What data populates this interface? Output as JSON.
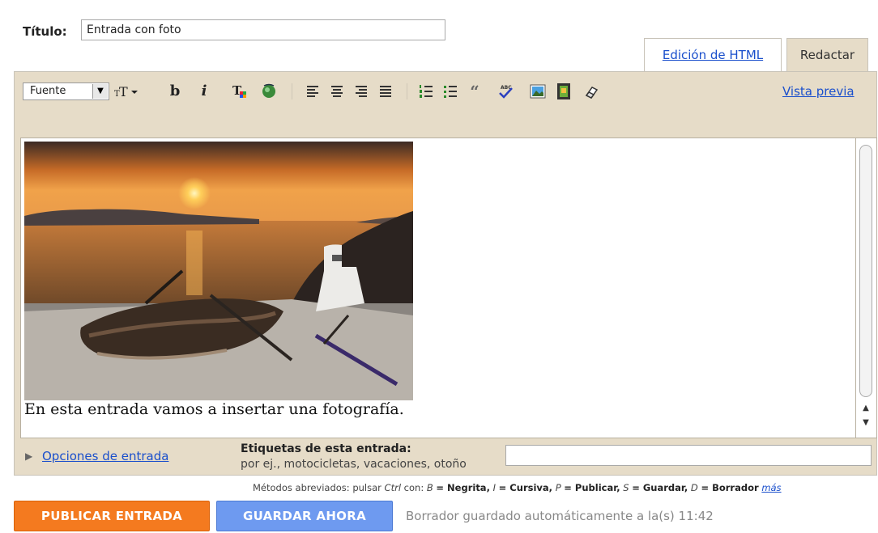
{
  "post": {
    "title_label": "Título:",
    "title_value": "Entrada con foto"
  },
  "tabs": {
    "html_label": "Edición de HTML",
    "compose_label": "Redactar"
  },
  "toolbar": {
    "font_label": "Fuente",
    "font_size_label": "TT",
    "bold_label": "b",
    "italic_label": "i",
    "preview_label": "Vista previa",
    "icons": [
      "font-size-icon",
      "bold-icon",
      "italic-icon",
      "text-color-icon",
      "link-icon",
      "align-left-icon",
      "align-center-icon",
      "align-right-icon",
      "justify-icon",
      "numbered-list-icon",
      "bullet-list-icon",
      "blockquote-icon",
      "spellcheck-icon",
      "insert-image-icon",
      "insert-video-icon",
      "remove-formatting-icon"
    ]
  },
  "content": {
    "body_text": "En esta entrada vamos a insertar una fotografía."
  },
  "options": {
    "link_label": "Opciones de entrada",
    "labels_title": "Etiquetas de esta entrada:",
    "labels_hint": "por ej., motocicletas, vacaciones, otoño",
    "labels_value": ""
  },
  "shortcuts": {
    "prefix": "Métodos abreviados: pulsar",
    "ctrl": "Ctrl",
    "con": "con:",
    "b_key": "B",
    "b_desc": "= Negrita,",
    "i_key": "I",
    "i_desc": "= Cursiva,",
    "p_key": "P",
    "p_desc": "= Publicar,",
    "s_key": "S",
    "s_desc": "= Guardar,",
    "d_key": "D",
    "d_desc": "= Borrador",
    "more": "más"
  },
  "actions": {
    "publish_label": "PUBLICAR ENTRADA",
    "save_label": "GUARDAR AHORA",
    "autosave_status": "Borrador guardado automáticamente a la(s) 11:42"
  },
  "colors": {
    "publish": "#f47a1f",
    "save": "#6e9af0",
    "link": "#1a4fcc",
    "editor_bg": "#e6dcc8"
  }
}
